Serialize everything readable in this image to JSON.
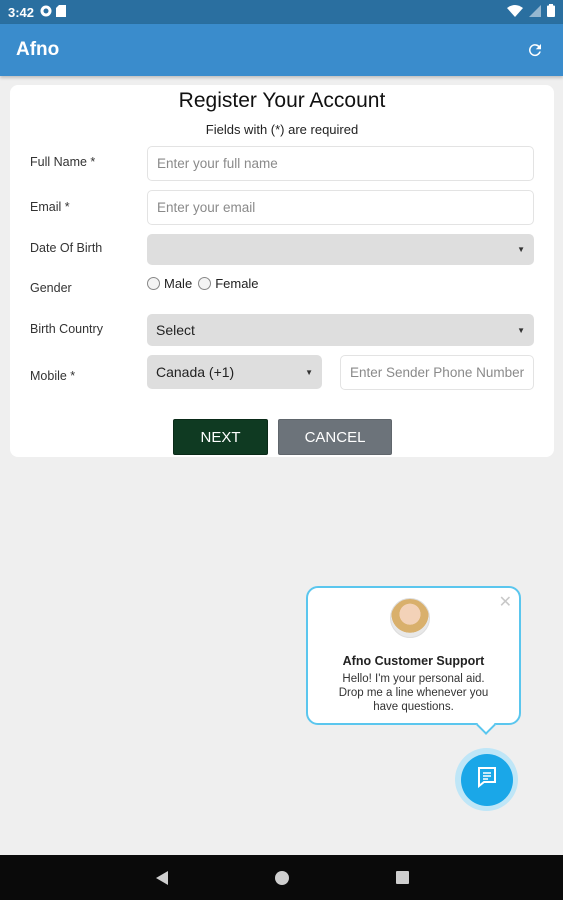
{
  "status_bar": {
    "time": "3:42"
  },
  "app_bar": {
    "title": "Afno"
  },
  "form": {
    "title": "Register Your Account",
    "required_note": "Fields with (*) are required",
    "full_name": {
      "label": "Full Name *",
      "placeholder": "Enter your full name",
      "value": ""
    },
    "email": {
      "label": "Email *",
      "placeholder": "Enter your email",
      "value": ""
    },
    "dob": {
      "label": "Date Of Birth",
      "value": ""
    },
    "gender": {
      "label": "Gender",
      "options": [
        "Male",
        "Female"
      ]
    },
    "birth_country": {
      "label": "Birth Country",
      "value": "Select"
    },
    "mobile": {
      "label": "Mobile *",
      "country_code": "Canada (+1)",
      "placeholder": "Enter Sender Phone Number",
      "value": ""
    },
    "next_label": "NEXT",
    "cancel_label": "CANCEL"
  },
  "chat_popup": {
    "name": "Afno Customer Support",
    "message": "Hello! I'm your personal aid. Drop me a line whenever you have questions."
  },
  "colors": {
    "status_bar": "#2a6fa0",
    "app_bar": "#3a8ccc",
    "next_button": "#0f3a22",
    "cancel_button": "#6c737a",
    "chat_accent": "#1aa7e8"
  },
  "icons": [
    "refresh-icon",
    "wifi-icon",
    "battery-icon",
    "close-icon",
    "chat-icon",
    "back-icon",
    "home-icon",
    "recents-icon"
  ]
}
